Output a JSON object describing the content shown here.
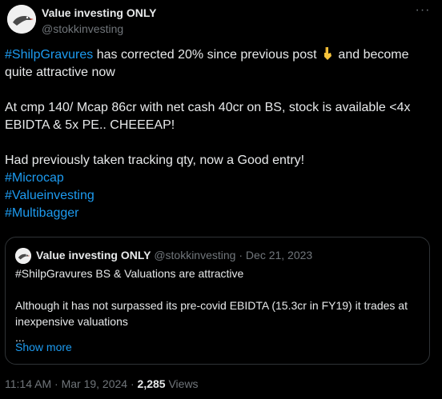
{
  "author": {
    "name": "Value investing ONLY",
    "handle": "@stokkinvesting"
  },
  "menu_icon": "more-horizontal-icon",
  "post": {
    "hashtag_lead": "#ShilpGravures",
    "line1_rest": " has corrected 20% since previous post ",
    "emoji": "backhand-index-pointing-down-emoji",
    "line1_tail": " and become quite attractive now",
    "para2": "At cmp 140/ Mcap 86cr with net cash 40cr on BS, stock is available <4x EBIDTA & 5x PE.. CHEEEAP!",
    "para3": "Had previously taken tracking qty, now a Good entry!",
    "hashtags": [
      "#Microcap",
      "#Valueinvesting",
      "#Multibagger"
    ]
  },
  "quote": {
    "name": "Value investing ONLY",
    "handle": "@stokkinvesting",
    "separator": " · ",
    "date": "Dec 21, 2023",
    "line1": "#ShilpGravures BS & Valuations are attractive",
    "para2": "Although it has not surpassed its pre-covid EBIDTA (15.3cr in FY19) it trades at inexpensive valuations",
    "ellipsis": "...",
    "show_more": "Show more"
  },
  "footer": {
    "time": "11:14 AM",
    "separator": " · ",
    "date": "Mar 19, 2024",
    "views_count": "2,285",
    "views_label": " Views"
  }
}
